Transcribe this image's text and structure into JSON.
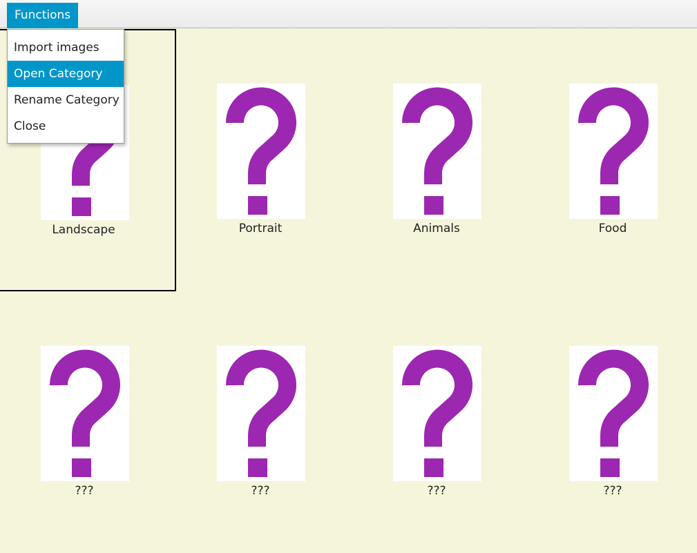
{
  "menubar": {
    "menu_label": "Functions"
  },
  "dropdown": {
    "items": [
      {
        "label": "Import images"
      },
      {
        "label": "Open Category"
      },
      {
        "label": "Rename Category"
      },
      {
        "label": "Close"
      }
    ],
    "highlighted_index": 1
  },
  "grid": {
    "selected_index": 0,
    "cells": [
      {
        "label": "Landscape",
        "icon": "question-mark-icon"
      },
      {
        "label": "Portrait",
        "icon": "question-mark-icon"
      },
      {
        "label": "Animals",
        "icon": "question-mark-icon"
      },
      {
        "label": "Food",
        "icon": "question-mark-icon"
      },
      {
        "label": "???",
        "icon": "question-mark-icon"
      },
      {
        "label": "???",
        "icon": "question-mark-icon"
      },
      {
        "label": "???",
        "icon": "question-mark-icon"
      },
      {
        "label": "???",
        "icon": "question-mark-icon"
      }
    ]
  },
  "colors": {
    "accent": "#0096c9",
    "background": "#f5f5dc",
    "placeholder_glyph": "#9c27b0"
  }
}
